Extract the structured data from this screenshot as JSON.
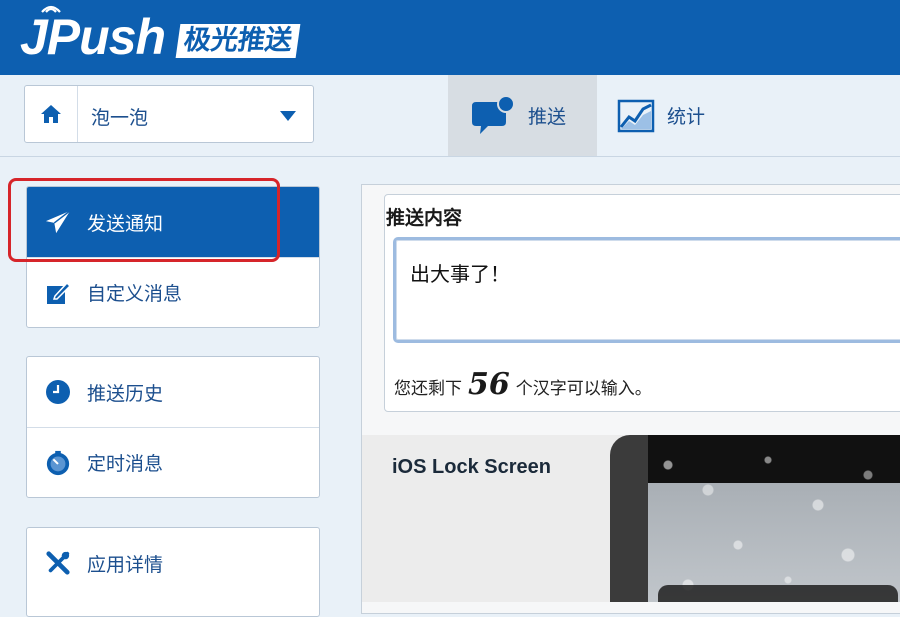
{
  "brand": {
    "logo_text": "JPush",
    "logo_badge": "极光推送",
    "primary_color": "#0d5fb0",
    "highlight_color": "#d6252a"
  },
  "app_selector": {
    "home_icon": "home-icon",
    "selected_app": "泡一泡",
    "caret_icon": "caret-down-icon"
  },
  "top_nav": [
    {
      "label": "推送",
      "icon": "chat-bubble-icon",
      "active": true
    },
    {
      "label": "统计",
      "icon": "chart-icon",
      "active": false
    }
  ],
  "sidebar": {
    "group1": [
      {
        "label": "发送通知",
        "icon": "paper-plane-icon",
        "active": true
      },
      {
        "label": "自定义消息",
        "icon": "edit-icon",
        "active": false
      }
    ],
    "group2": [
      {
        "label": "推送历史",
        "icon": "clock-icon",
        "active": false
      },
      {
        "label": "定时消息",
        "icon": "timer-icon",
        "active": false
      }
    ],
    "group3": [
      {
        "label": "应用详情",
        "icon": "tools-icon",
        "active": false
      }
    ]
  },
  "push_content": {
    "title": "推送内容",
    "message": "出大事了！",
    "remaining_prefix": "您还剩下",
    "remaining_count": "56",
    "remaining_suffix": "个汉字可以输入。"
  },
  "preview": {
    "title": "iOS Lock Screen"
  }
}
